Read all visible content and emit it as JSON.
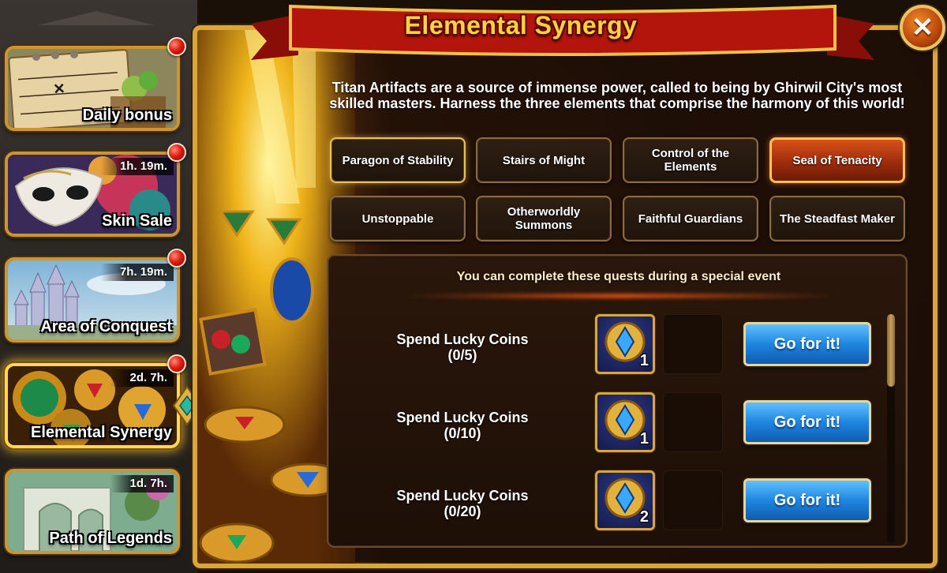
{
  "sidebar": {
    "items": [
      {
        "label": "Daily bonus",
        "timer": "",
        "badge": true
      },
      {
        "label": "Skin Sale",
        "timer": "1h. 19m.",
        "badge": true
      },
      {
        "label": "Area of Conquest",
        "timer": "7h. 19m.",
        "badge": true
      },
      {
        "label": "Elemental Synergy",
        "timer": "2d. 7h.",
        "badge": true,
        "active": true
      },
      {
        "label": "Path of Legends",
        "timer": "1d. 7h.",
        "badge": false
      }
    ]
  },
  "header": {
    "title": "Elemental Synergy",
    "close_icon": "close-x-icon"
  },
  "description": "Titan Artifacts are a source of immense power, called to being by Ghirwil City's most skilled masters. Harness the three elements that comprise the harmony of this world!",
  "tabs": [
    {
      "label": "Paragon of Stability"
    },
    {
      "label": "Stairs of Might"
    },
    {
      "label": "Control of the Elements"
    },
    {
      "label": "Seal of Tenacity"
    },
    {
      "label": "Unstoppable"
    },
    {
      "label": "Otherworldly Summons"
    },
    {
      "label": "Faithful Guardians"
    },
    {
      "label": "The Steadfast Maker"
    }
  ],
  "quests": {
    "header": "You can complete these quests during a special event",
    "rows": [
      {
        "name": "Spend Lucky Coins",
        "progress": "(0/5)",
        "reward_icon": "artifact-coin-icon",
        "reward_count": "1",
        "button": "Go for it!"
      },
      {
        "name": "Spend Lucky Coins",
        "progress": "(0/10)",
        "reward_icon": "artifact-coin-icon",
        "reward_count": "1",
        "button": "Go for it!"
      },
      {
        "name": "Spend Lucky Coins",
        "progress": "(0/20)",
        "reward_icon": "artifact-coin-icon",
        "reward_count": "2",
        "button": "Go for it!"
      }
    ]
  },
  "colors": {
    "frame_gold": "#d9a63a",
    "title_yellow": "#ffd23d",
    "ribbon_red": "#b3140c",
    "active_tab": "#d9531a",
    "go_button_blue": "#1f86e0"
  }
}
